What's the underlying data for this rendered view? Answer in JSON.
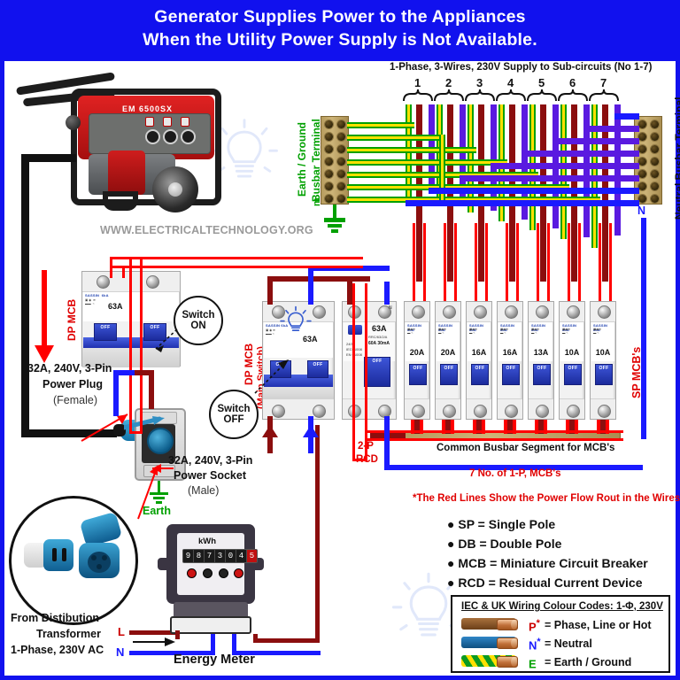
{
  "banner": {
    "line1": "Generator Supplies Power to the Appliances",
    "line2": "When the Utility Power Supply is Not Available.",
    "bg_color": "#1111ee",
    "text_color": "#ffffff"
  },
  "watermark": {
    "url": "WWW.ELECTRICALTECHNOLOGY.ORG"
  },
  "generator": {
    "model": "EM 6500SX"
  },
  "top": {
    "supply_caption": "1-Phase, 3-Wires, 230V Supply to Sub-circuits (No 1-7)",
    "circuit_numbers": [
      "1",
      "2",
      "3",
      "4",
      "5",
      "6",
      "7"
    ]
  },
  "busbars": {
    "earth_label": "Earth / Ground\nBusbar Terminal",
    "earth_label_line1": "Earth / Ground",
    "earth_label_line2": "Busbar Terminal",
    "earth_terminal_mark": "m",
    "neutral_label": "Neutral Busbar Terminal",
    "neutral_mark": "N"
  },
  "left_side": {
    "dp_mcb_label": "DP MCB",
    "dp_mcb_rating": "63A",
    "switch_on": "Switch\nON",
    "switch_on_l1": "Switch",
    "switch_on_l2": "ON",
    "plug_label_l1": "32A, 240V, 3-Pin",
    "plug_label_l2": "Power Plug",
    "plug_label_l3": "(Female)",
    "socket_label_l1": "32A, 240V, 3-Pin",
    "socket_label_l2": "Power Socket",
    "socket_label_l3": "(Male)",
    "earth_label": "Earth",
    "transformer_l1": "From Distibution",
    "transformer_l2": "Transformer",
    "transformer_l3": "1-Phase, 230V AC",
    "line_mark": "L",
    "neutral_mark": "N",
    "meter_title": "Energy Meter",
    "meter_unit": "kWh",
    "meter_digits": [
      "9",
      "8",
      "7",
      "3",
      "0",
      "4"
    ],
    "meter_last_digit": "5"
  },
  "db": {
    "main_dp_label_l1": "DP MCB",
    "main_dp_label_l2": "(Main Switch)",
    "main_dp_rating": "63A",
    "switch_off_l1": "Switch",
    "switch_off_l2": "OFF",
    "rcd_rating": "63A",
    "rcd_spec_l1": "RRC/63/2/A",
    "rcd_spec_l2": "60A  30mA",
    "rcd_test": "T",
    "rcd_side_l1": "240V",
    "rcd_side_l2": "IEC61008",
    "rcd_side_l3": "EN 61008",
    "rcd_label_l1": "2-P",
    "rcd_label_l2": "RCD",
    "sp_mcb_label": "SP  MCB's",
    "mcb_ratings": [
      "20A",
      "20A",
      "16A",
      "16A",
      "13A",
      "10A",
      "10A"
    ],
    "mcb_toggle_text": "OFF",
    "busbar_caption": "Common Busbar Segment for MCB's"
  },
  "notes": {
    "mcb_count": "7 No. of 1-P, MCB's",
    "red_line_note": "*The Red Lines Show the Power Flow Rout in the Wires.",
    "abbreviations": [
      "SP = Single Pole",
      "DB = Double Pole",
      "MCB = Miniature Circuit Breaker",
      "RCD = Residual Current Device"
    ]
  },
  "colour_legend": {
    "title": "IEC & UK Wiring Colour Codes: 1-Φ, 230V",
    "rows": [
      {
        "symbol": "P",
        "sup": "*",
        "symbol_color": "#cc0000",
        "cable_color": "#8b5a2b",
        "text": "=   Phase, Line or  Hot"
      },
      {
        "symbol": "N",
        "sup": "*",
        "symbol_color": "#1a1aff",
        "cable_color": "#1f6fc0",
        "text": "=   Neutral"
      },
      {
        "symbol": "E",
        "sup": "",
        "symbol_color": "#00a000",
        "cable_color": "#00a000",
        "text": "=   Earth / Ground"
      }
    ]
  },
  "colors": {
    "phase": "#8b0e0e",
    "neutral": "#1a1aff",
    "earth": "#00a000",
    "earth_stripe": "#ffe000",
    "power_flow": "#ff0000",
    "frame": "#1111ee",
    "busbar": "#c0a464"
  }
}
